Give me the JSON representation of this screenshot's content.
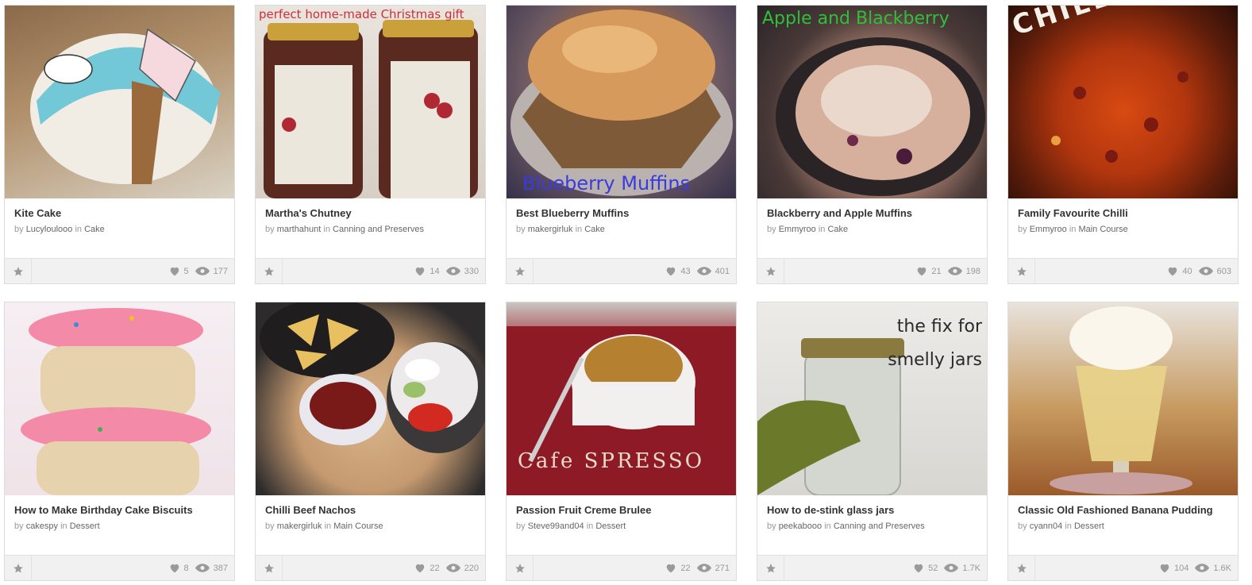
{
  "colors": {
    "card_border": "#dcdcdc",
    "footer_bg": "#f1f1f1",
    "title": "#333333",
    "meta": "#999999",
    "icon": "#9a9a9a"
  },
  "icons": {
    "favorite": "star-icon",
    "likes": "heart-icon",
    "views": "eye-icon"
  },
  "cards": [
    {
      "image_caption": "",
      "title": "Kite Cake",
      "by": "by",
      "author": "Lucyloulooo",
      "in": "in",
      "category": "Cake",
      "likes": "5",
      "views": "177"
    },
    {
      "image_caption": "perfect home-made Christmas gift",
      "title": "Martha's Chutney",
      "by": "by",
      "author": "marthahunt",
      "in": "in",
      "category": "Canning and Preserves",
      "likes": "14",
      "views": "330"
    },
    {
      "image_caption": "Blueberry Muffins",
      "title": "Best Blueberry Muffins",
      "by": "by",
      "author": "makergirluk",
      "in": "in",
      "category": "Cake",
      "likes": "43",
      "views": "401"
    },
    {
      "image_caption": "Apple and Blackberry",
      "title": "Blackberry and Apple Muffins",
      "by": "by",
      "author": "Emmyroo",
      "in": "in",
      "category": "Cake",
      "likes": "21",
      "views": "198"
    },
    {
      "image_caption": "CHILLI TIME",
      "title": "Family Favourite Chilli",
      "by": "by",
      "author": "Emmyroo",
      "in": "in",
      "category": "Main Course",
      "likes": "40",
      "views": "603"
    },
    {
      "image_caption": "",
      "title": "How to Make Birthday Cake Biscuits",
      "by": "by",
      "author": "cakespy",
      "in": "in",
      "category": "Dessert",
      "likes": "8",
      "views": "387"
    },
    {
      "image_caption": "",
      "title": "Chilli Beef Nachos",
      "by": "by",
      "author": "makergirluk",
      "in": "in",
      "category": "Main Course",
      "likes": "22",
      "views": "220"
    },
    {
      "image_caption": "Cafe SPRESSO",
      "title": "Passion Fruit Creme Brulee",
      "by": "by",
      "author": "Steve99and04",
      "in": "in",
      "category": "Dessert",
      "likes": "22",
      "views": "271"
    },
    {
      "image_caption": "the fix for smelly jars",
      "title": "How to de-stink glass jars",
      "by": "by",
      "author": "peekabooo",
      "in": "in",
      "category": "Canning and Preserves",
      "likes": "52",
      "views": "1.7K"
    },
    {
      "image_caption": "",
      "title": "Classic Old Fashioned Banana Pudding",
      "by": "by",
      "author": "cyann04",
      "in": "in",
      "category": "Dessert",
      "likes": "104",
      "views": "1.6K"
    }
  ]
}
